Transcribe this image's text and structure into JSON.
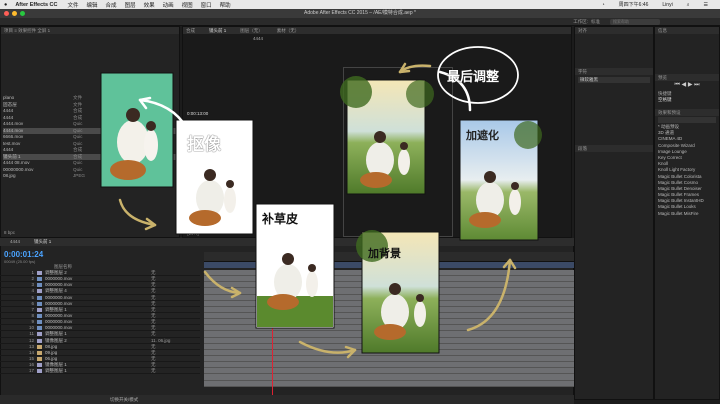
{
  "menubar": {
    "app": "After Effects CC",
    "items": [
      "文件",
      "编辑",
      "合成",
      "图层",
      "效果",
      "动画",
      "视图",
      "窗口",
      "帮助"
    ],
    "clock": "周四下午6:46",
    "user": "Linyi"
  },
  "window": {
    "title": "Adobe After Effects CC 2015 – /AE/模特合成.aep *"
  },
  "toolbar": {
    "workspace_label": "工作区:",
    "workspace_value": "标准",
    "search_placeholder": "搜索帮助"
  },
  "project": {
    "tab": "项目 ≡  效果控件 全屏 1",
    "items": [
      {
        "name": "plano",
        "type": "文件"
      },
      {
        "name": "固态层",
        "type": "文件"
      },
      {
        "name": "4444",
        "type": "合成"
      },
      {
        "name": "4444",
        "type": "合成"
      },
      {
        "name": "4444.mov",
        "type": "Quic"
      },
      {
        "name": "4444.mov",
        "type": "Quic"
      },
      {
        "name": "6666.mov",
        "type": "Quic"
      },
      {
        "name": "test.mov",
        "type": "Quic"
      },
      {
        "name": "4444",
        "type": "合成"
      },
      {
        "name": "镜头前 1",
        "type": "合成"
      },
      {
        "name": "4444 08.mov",
        "type": "Quic"
      },
      {
        "name": "00000000.mov",
        "type": "Quic"
      },
      {
        "name": "08.jpg",
        "type": "JPEG"
      }
    ],
    "bpc": "8 bpc"
  },
  "viewer": {
    "tabs": [
      "合成",
      "镜头前 1",
      "图层（无）",
      "素材（无）"
    ],
    "breadcrumb": "4444",
    "zoom": "(50%)",
    "timecode": "0:00:13:00"
  },
  "timeline": {
    "tabs": [
      "4444",
      "镜头前 1"
    ],
    "timecode": "0:00:01:24",
    "frames": "00049 (25.00 fps)",
    "layer_col": "图层名称",
    "layers": [
      {
        "n": "1",
        "name": "调整图层 2",
        "color": "#a0a0c8"
      },
      {
        "n": "2",
        "name": "0000000.mov",
        "color": "#6f8fbf"
      },
      {
        "n": "3",
        "name": "0000000.mov",
        "color": "#6f8fbf"
      },
      {
        "n": "4",
        "name": "调整图层 4",
        "color": "#a0a0c8"
      },
      {
        "n": "5",
        "name": "0000000.mov",
        "color": "#6f8fbf"
      },
      {
        "n": "6",
        "name": "0000000.mov",
        "color": "#6f8fbf"
      },
      {
        "n": "7",
        "name": "调整图层 1",
        "color": "#a0a0c8"
      },
      {
        "n": "8",
        "name": "0000000.mov",
        "color": "#6f8fbf"
      },
      {
        "n": "9",
        "name": "0000000.mov",
        "color": "#6f8fbf"
      },
      {
        "n": "10",
        "name": "0000000.mov",
        "color": "#6f8fbf"
      },
      {
        "n": "11",
        "name": "调整图层 1",
        "color": "#a0a0c8"
      },
      {
        "n": "12",
        "name": "镜像图层 2",
        "color": "#a0a0c8"
      },
      {
        "n": "13",
        "name": "08.jpg",
        "color": "#c7a86f"
      },
      {
        "n": "14",
        "name": "09.jpg",
        "color": "#c7a86f"
      },
      {
        "n": "15",
        "name": "06.jpg",
        "color": "#c7a86f"
      },
      {
        "n": "16",
        "name": "镜像图层 1",
        "color": "#a0a0c8"
      },
      {
        "n": "17",
        "name": "调整图层 1",
        "color": "#a0a0c8"
      }
    ],
    "parent_value": "无",
    "parent_special": "11. 06.jpg",
    "bottom": "切换开关/模式"
  },
  "right_panel": {
    "align_title": "对齐",
    "char_title": "字符",
    "font_value": "微软雅黑",
    "para_title": "段落",
    "preview_title": "预览",
    "preview_label": "快捷键",
    "preview_value": "空格键",
    "effects_title": "效果和预设",
    "effects": [
      "* 动画预设",
      "3D 通道",
      "CINEMA 4D",
      "Composite Wizard",
      "Image Lounge",
      "Key Correct",
      "Knoll",
      "Knoll Light Factory",
      "Magic Bullet Colorista",
      "Magic Bullet Cosmo",
      "Magic Bullet Denoiser",
      "Magic Bullet Frames",
      "Magic Bullet InstantHD",
      "Magic Bullet Looks",
      "Magic Bullet MisFire"
    ],
    "info_title": "信息"
  },
  "annotations": {
    "top": "最后调整",
    "right": "加遮化",
    "cutout": "抠像",
    "fill": "补草皮",
    "bg": "加背景"
  },
  "colors": {
    "accent": "#4aa3ff",
    "playhead": "#dd2233",
    "green_screen": "#5fc29a"
  }
}
